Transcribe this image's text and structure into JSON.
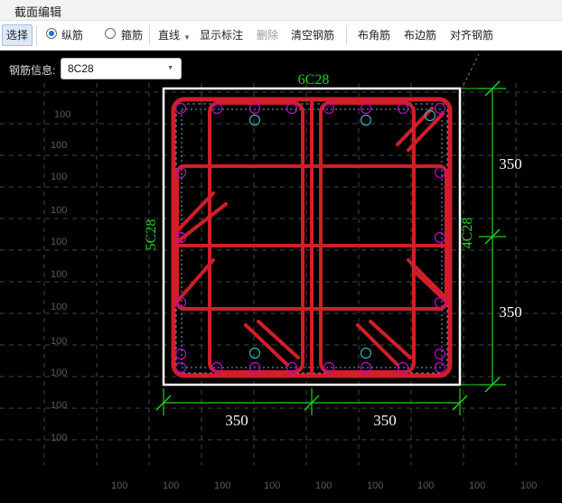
{
  "window": {
    "title": "截面编辑"
  },
  "toolbar": {
    "select_label": "选择",
    "longitudinal_label": "纵筋",
    "stirrup_label": "箍筋",
    "line_label": "直线",
    "show_dims_label": "显示标注",
    "delete_label": "删除",
    "clear_label": "清空钢筋",
    "corner_label": "布角筋",
    "edge_label": "布边筋",
    "align_label": "对齐钢筋",
    "rebar_type": "longitudinal"
  },
  "rebar_info": {
    "label": "钢筋信息:",
    "value": "8C28"
  },
  "drawing": {
    "top_rebar": "6C28",
    "left_rebar": "5C28",
    "right_rebar": "4C28",
    "dim_right_upper": "350",
    "dim_right_lower": "350",
    "dim_bottom_left": "350",
    "dim_bottom_right": "350",
    "grid_label": "100",
    "colors": {
      "rebar": "#d01e2a",
      "dimension": "#1fd11f",
      "section_border": "#ffffff",
      "bar_marker": "#c800c8",
      "bar_marker_alt": "#2fb6b6"
    }
  }
}
